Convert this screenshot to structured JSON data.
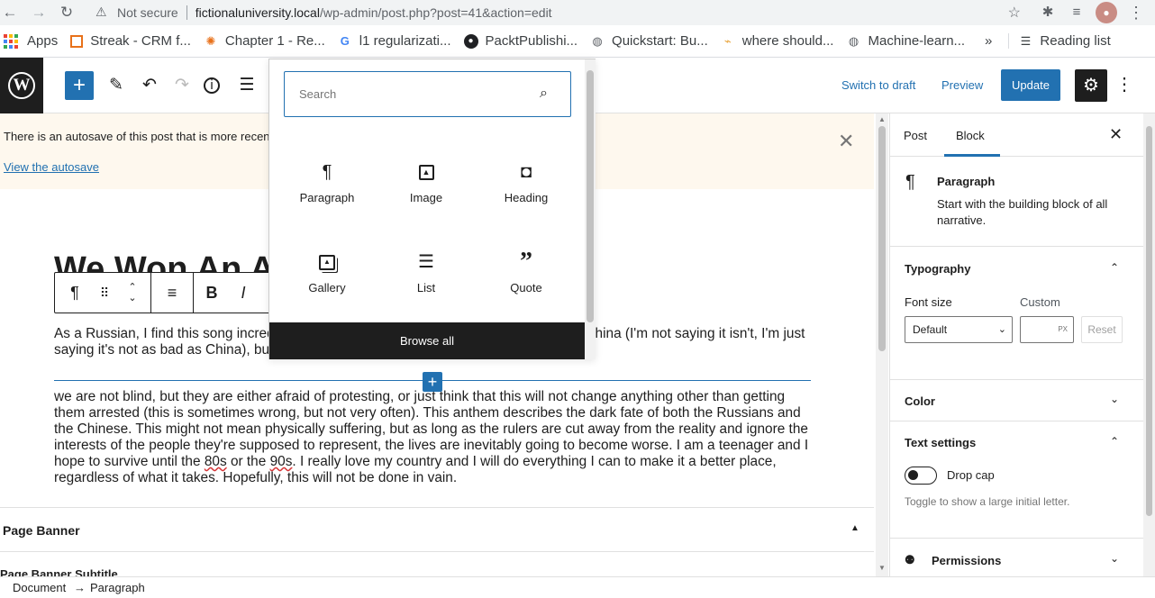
{
  "browser": {
    "url_host": "fictionaluniversity.local",
    "url_path": "/wp-admin/post.php?post=41&action=edit",
    "security_label": "Not secure",
    "bookmarks": [
      {
        "label": "Apps",
        "icon": "apps-grid-icon"
      },
      {
        "label": "Streak - CRM f...",
        "icon": "streak-icon",
        "color": "#e8711a"
      },
      {
        "label": "Chapter 1 - Re...",
        "icon": "gear-icon",
        "color": "#e8711a"
      },
      {
        "label": "l1 regularizati...",
        "icon": "google-icon",
        "color": "#4285f4"
      },
      {
        "label": "PacktPublishi...",
        "icon": "github-icon",
        "color": "#202124"
      },
      {
        "label": "Quickstart: Bu...",
        "icon": "globe-icon",
        "color": "#5f6368"
      },
      {
        "label": "where should...",
        "icon": "bookmark-icon",
        "color": "#e8a33a"
      },
      {
        "label": "Machine-learn...",
        "icon": "globe-icon",
        "color": "#5f6368"
      }
    ],
    "more_bookmarks": "»",
    "reading_list": "Reading list"
  },
  "header": {
    "switch_to_draft": "Switch to draft",
    "preview": "Preview",
    "update": "Update"
  },
  "notice": {
    "message": "There is an autosave of this post that is more recent than the version below.",
    "link": "View the autosave"
  },
  "post": {
    "title": "We Won An Award",
    "paragraph1": "As a Russian, I find this song incredibly accurate. Russia is not quite as oppressive as China (I'm not saying it isn't, I'm just saying it's not as bad as China), but a lot of people disagree with the government,",
    "paragraph2_pre": "we are not blind, but they are either afraid of protesting, or just think that this will not change anything other than getting them arrested (this is sometimes wrong, but not very often). This anthem describes the dark fate of both the Russians and the Chinese. This might not mean physically suffering, but as long as the rulers are cut away from the reality and ignore the interests of the people they're supposed to represent, the lives are inevitably going to become worse. I am a teenager and I hope to survive until the ",
    "paragraph2_80s": "80s",
    "paragraph2_mid": " or the ",
    "paragraph2_90s": "90s",
    "paragraph2_post": ". I really love my country and I will do everything I can to make it a better place, regardless of what it takes. Hopefully, this will not be done in vain."
  },
  "meta_boxes": {
    "page_banner": "Page Banner",
    "page_banner_subtitle": "Page Banner Subtitle"
  },
  "inserter": {
    "search_placeholder": "Search",
    "blocks": [
      {
        "label": "Paragraph",
        "icon": "paragraph-icon"
      },
      {
        "label": "Image",
        "icon": "image-icon"
      },
      {
        "label": "Heading",
        "icon": "heading-icon"
      },
      {
        "label": "Gallery",
        "icon": "gallery-icon"
      },
      {
        "label": "List",
        "icon": "list-icon"
      },
      {
        "label": "Quote",
        "icon": "quote-icon"
      }
    ],
    "browse_all": "Browse all"
  },
  "sidebar": {
    "tab_post": "Post",
    "tab_block": "Block",
    "block_name": "Paragraph",
    "block_desc": "Start with the building block of all narrative.",
    "typography": "Typography",
    "font_size_label": "Font size",
    "custom_label": "Custom",
    "font_size_value": "Default",
    "unit": "PX",
    "reset": "Reset",
    "color": "Color",
    "text_settings": "Text settings",
    "drop_cap": "Drop cap",
    "drop_cap_help": "Toggle to show a large initial letter.",
    "permissions": "Permissions"
  },
  "footer": {
    "crumb1": "Document",
    "arrow": "→",
    "crumb2": "Paragraph"
  },
  "colors": {
    "accent": "#2271b1",
    "dark": "#1e1e1e"
  }
}
